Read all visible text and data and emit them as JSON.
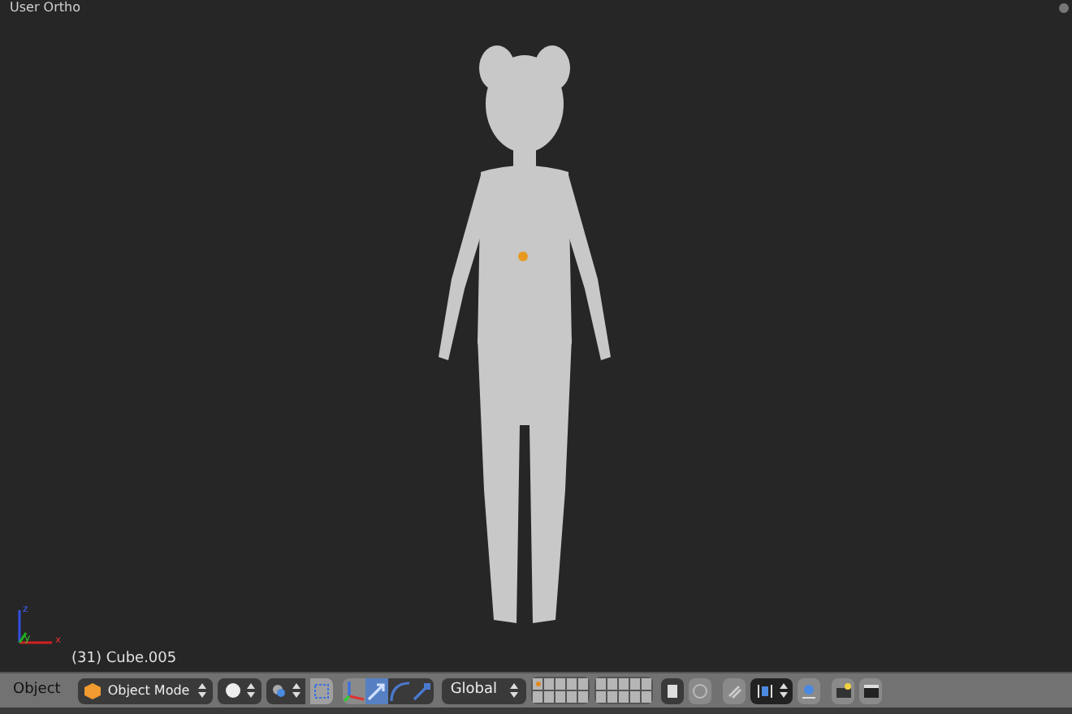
{
  "viewport": {
    "view_label": "User Ortho",
    "object_label": "(31) Cube.005",
    "axes": {
      "x": "x",
      "y": "y",
      "z": "z"
    }
  },
  "header": {
    "menu": "Object",
    "mode": "Object Mode",
    "orientation": "Global",
    "manipulators": [
      {
        "kind": "axes",
        "selected": false
      },
      {
        "kind": "translate",
        "selected": true
      },
      {
        "kind": "rotate",
        "selected": false
      },
      {
        "kind": "scale",
        "selected": false
      }
    ]
  }
}
